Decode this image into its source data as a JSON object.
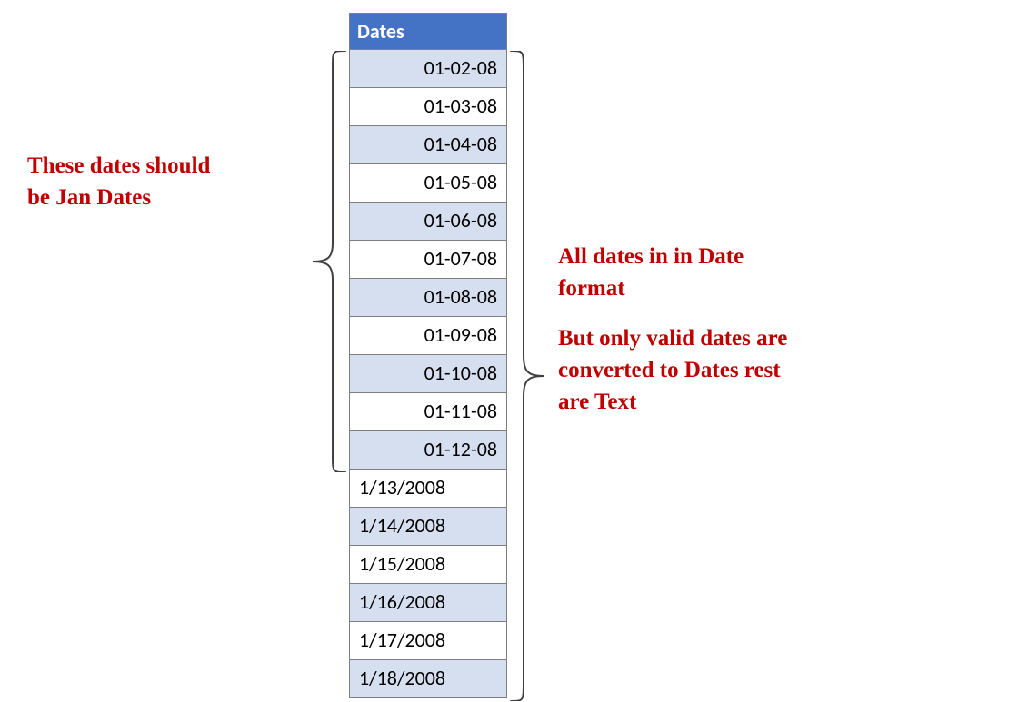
{
  "table": {
    "header": "Dates",
    "cells": [
      {
        "value": "01-02-08",
        "align": "right",
        "bg": "odd"
      },
      {
        "value": "01-03-08",
        "align": "right",
        "bg": "even"
      },
      {
        "value": "01-04-08",
        "align": "right",
        "bg": "odd"
      },
      {
        "value": "01-05-08",
        "align": "right",
        "bg": "even"
      },
      {
        "value": "01-06-08",
        "align": "right",
        "bg": "odd"
      },
      {
        "value": "01-07-08",
        "align": "right",
        "bg": "even"
      },
      {
        "value": "01-08-08",
        "align": "right",
        "bg": "odd"
      },
      {
        "value": "01-09-08",
        "align": "right",
        "bg": "even"
      },
      {
        "value": "01-10-08",
        "align": "right",
        "bg": "odd"
      },
      {
        "value": "01-11-08",
        "align": "right",
        "bg": "even"
      },
      {
        "value": "01-12-08",
        "align": "right",
        "bg": "odd"
      },
      {
        "value": "1/13/2008",
        "align": "left",
        "bg": "even"
      },
      {
        "value": "1/14/2008",
        "align": "left",
        "bg": "odd"
      },
      {
        "value": "1/15/2008",
        "align": "left",
        "bg": "even"
      },
      {
        "value": "1/16/2008",
        "align": "left",
        "bg": "odd"
      },
      {
        "value": "1/17/2008",
        "align": "left",
        "bg": "even"
      },
      {
        "value": "1/18/2008",
        "align": "left",
        "bg": "odd"
      }
    ]
  },
  "annotations": {
    "left_line1": "These dates should",
    "left_line2": "be Jan Dates",
    "right_line1": "All dates in in Date",
    "right_line2": "format",
    "right_line3": "But only valid dates are",
    "right_line4": "converted to Dates rest",
    "right_line5": "are Text"
  }
}
